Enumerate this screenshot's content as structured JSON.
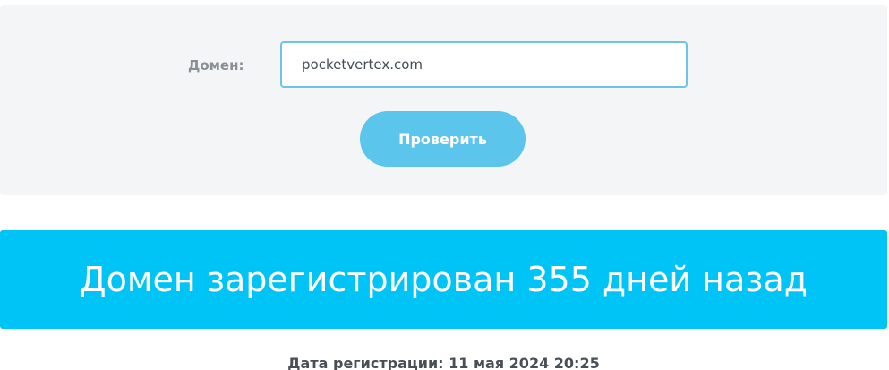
{
  "form": {
    "domain_label": "Домен:",
    "domain_value": "pocketvertex.com",
    "check_button_label": "Проверить"
  },
  "result": {
    "headline": "Домен зарегистрирован 355 дней назад",
    "registration_date": "Дата регистрации: 11 мая 2024 20:25"
  },
  "colors": {
    "panel_background": "#f3f5f7",
    "accent_button": "#5bc5ec",
    "banner": "#00c4f5",
    "input_border": "#6ec4e8"
  }
}
